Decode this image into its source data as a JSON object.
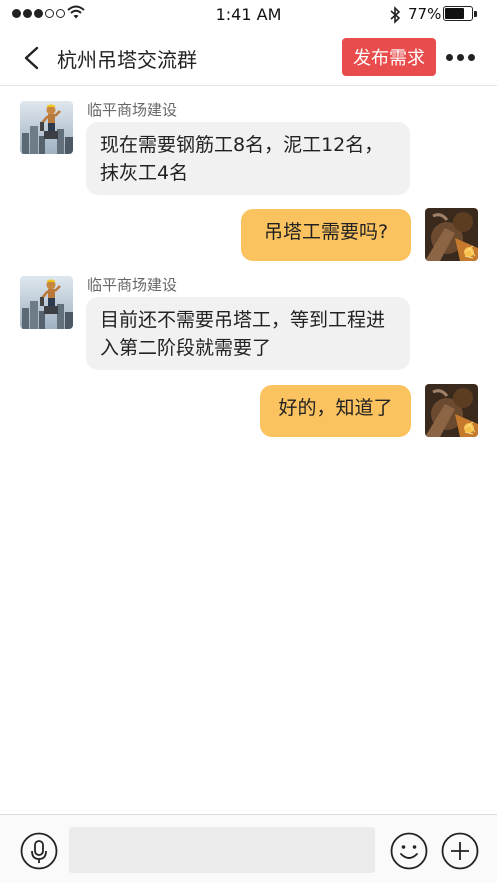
{
  "status_bar": {
    "time": "1:41 AM",
    "battery_percent": "77%",
    "battery_level": 0.77,
    "signal_bars_filled": 3,
    "signal_bars_total": 5
  },
  "header": {
    "title": "杭州吊塔交流群",
    "publish_button": "发布需求"
  },
  "messages": [
    {
      "direction": "incoming",
      "sender": "临平商场建设",
      "text": "现在需要钢筋工8名，泥工12名，抹灰工4名"
    },
    {
      "direction": "outgoing",
      "text": "吊塔工需要吗?"
    },
    {
      "direction": "incoming",
      "sender": "临平商场建设",
      "text": "目前还不需要吊塔工，等到工程进入第二阶段就需要了"
    },
    {
      "direction": "outgoing",
      "text": "好的，知道了"
    }
  ],
  "input_bar": {
    "placeholder": ""
  },
  "colors": {
    "accent": "#e84c4c",
    "outgoing_bubble": "#fbc35f",
    "incoming_bubble": "#f1f1f1"
  }
}
